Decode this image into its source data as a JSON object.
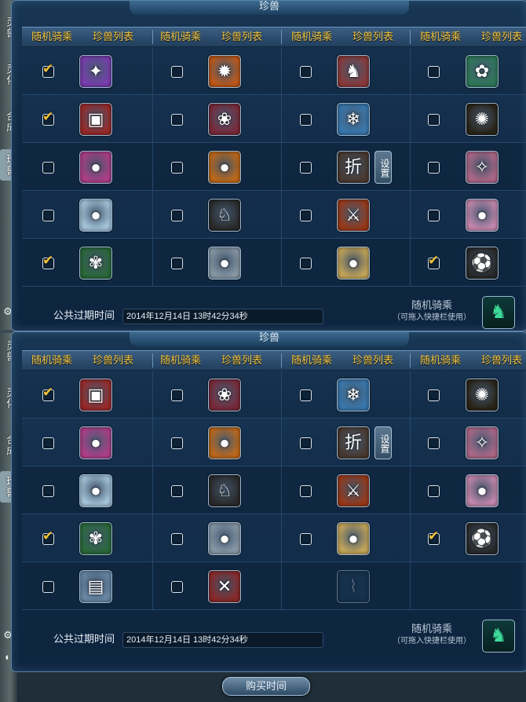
{
  "top": {
    "title": "珍兽",
    "header": [
      "随机骑乘",
      "珍兽列表",
      "随机骑乘",
      "珍兽列表",
      "随机骑乘",
      "珍兽列表",
      "随机骑乘",
      "珍兽列表"
    ],
    "rows": [
      [
        {
          "checked": true,
          "icon": "purple-feather-icon",
          "glyph": "✦",
          "bg": "#7a3fb0"
        },
        {
          "checked": false,
          "icon": "fire-beast-icon",
          "glyph": "✹",
          "bg": "#c05a1a"
        },
        {
          "checked": false,
          "icon": "white-horse-icon",
          "glyph": "♞",
          "bg": "#8c3a3a"
        },
        {
          "checked": false,
          "icon": "green-dragon-icon",
          "glyph": "✿",
          "bg": "#2f7a5a"
        }
      ],
      [
        {
          "checked": true,
          "icon": "red-chest-icon",
          "glyph": "▣",
          "bg": "#9a2a2a"
        },
        {
          "checked": false,
          "icon": "flower-beast-icon",
          "glyph": "❀",
          "bg": "#7a2a3a"
        },
        {
          "checked": false,
          "icon": "blue-alpaca-icon",
          "glyph": "❄",
          "bg": "#3a7ab0"
        },
        {
          "checked": false,
          "icon": "gold-swirl-icon",
          "glyph": "✺",
          "bg": "#2a2418"
        }
      ],
      [
        {
          "checked": false,
          "icon": "pink-alpaca-icon",
          "glyph": "●",
          "bg": "#b0408a"
        },
        {
          "checked": false,
          "icon": "orange-alpaca-icon",
          "glyph": "●",
          "bg": "#c06a1a"
        },
        {
          "checked": false,
          "icon": "discount-badge-icon",
          "glyph": "折",
          "bg": "#4a3a30",
          "setting": "设置"
        },
        {
          "checked": false,
          "icon": "pink-unicorn-icon",
          "glyph": "✧",
          "bg": "#b06a8a"
        }
      ],
      [
        {
          "checked": false,
          "icon": "white-bear-icon",
          "glyph": "●",
          "bg": "#a8c8dc"
        },
        {
          "checked": false,
          "icon": "black-white-horse-icon",
          "glyph": "♘",
          "bg": "#2a2a2a"
        },
        {
          "checked": false,
          "icon": "sword-gift-icon",
          "glyph": "⚔",
          "bg": "#9a3a1a"
        },
        {
          "checked": false,
          "icon": "pink-bear-icon",
          "glyph": "●",
          "bg": "#c88ab0"
        }
      ],
      [
        {
          "checked": true,
          "icon": "green-dragon-scale-icon",
          "glyph": "✾",
          "bg": "#2a6a3a"
        },
        {
          "checked": false,
          "icon": "white-lion-icon",
          "glyph": "●",
          "bg": "#8a9aa8"
        },
        {
          "checked": false,
          "icon": "cream-alpaca-icon",
          "glyph": "●",
          "bg": "#c8a85a"
        },
        {
          "checked": true,
          "icon": "panda-ball-icon",
          "glyph": "⚽",
          "bg": "#2a2a2a"
        }
      ]
    ],
    "footer": {
      "expire_label": "公共过期时间",
      "expire_time": "2014年12月14日 13时42分34秒",
      "ride_label": "随机骑乘",
      "ride_hint": "（可拖入快捷栏使用）"
    }
  },
  "bottom": {
    "title": "珍兽",
    "header": [
      "随机骑乘",
      "珍兽列表",
      "随机骑乘",
      "珍兽列表",
      "随机骑乘",
      "珍兽列表",
      "随机骑乘",
      "珍兽列表"
    ],
    "rows": [
      [
        {
          "checked": true,
          "icon": "red-chest-icon",
          "glyph": "▣",
          "bg": "#9a2a2a"
        },
        {
          "checked": false,
          "icon": "flower-beast-icon",
          "glyph": "❀",
          "bg": "#7a2a3a"
        },
        {
          "checked": false,
          "icon": "blue-alpaca-icon",
          "glyph": "❄",
          "bg": "#3a7ab0"
        },
        {
          "checked": false,
          "icon": "gold-swirl-icon",
          "glyph": "✺",
          "bg": "#2a2418"
        }
      ],
      [
        {
          "checked": false,
          "icon": "pink-alpaca-icon",
          "glyph": "●",
          "bg": "#b0408a"
        },
        {
          "checked": false,
          "icon": "orange-alpaca-icon",
          "glyph": "●",
          "bg": "#c06a1a"
        },
        {
          "checked": false,
          "icon": "discount-badge-icon",
          "glyph": "折",
          "bg": "#4a3a30",
          "setting": "设置"
        },
        {
          "checked": false,
          "icon": "pink-unicorn-icon",
          "glyph": "✧",
          "bg": "#b06a8a"
        }
      ],
      [
        {
          "checked": false,
          "icon": "white-bear-icon",
          "glyph": "●",
          "bg": "#a8c8dc"
        },
        {
          "checked": false,
          "icon": "black-white-horse-icon",
          "glyph": "♘",
          "bg": "#2a2a2a"
        },
        {
          "checked": false,
          "icon": "sword-gift-icon",
          "glyph": "⚔",
          "bg": "#9a3a1a"
        },
        {
          "checked": false,
          "icon": "pink-bear-icon",
          "glyph": "●",
          "bg": "#c88ab0"
        }
      ],
      [
        {
          "checked": true,
          "icon": "green-dragon-scale-icon",
          "glyph": "✾",
          "bg": "#2a6a3a"
        },
        {
          "checked": false,
          "icon": "white-lion-icon",
          "glyph": "●",
          "bg": "#8a9aa8"
        },
        {
          "checked": false,
          "icon": "cream-alpaca-icon",
          "glyph": "●",
          "bg": "#c8a85a"
        },
        {
          "checked": true,
          "icon": "panda-ball-icon",
          "glyph": "⚽",
          "bg": "#2a2a2a"
        }
      ],
      [
        {
          "checked": false,
          "icon": "white-tiger-icon",
          "glyph": "▤",
          "bg": "#6a8aa8"
        },
        {
          "checked": false,
          "icon": "red-cross-scroll-icon",
          "glyph": "✕",
          "bg": "#8a2a2a"
        },
        {
          "empty": true,
          "icon": "empty-slot-icon",
          "glyph": "⌇"
        },
        {
          "empty": true,
          "none": true
        }
      ]
    ],
    "footer": {
      "expire_label": "公共过期时间",
      "expire_time": "2014年12月14日 13时42分34秒",
      "ride_label": "随机骑乘",
      "ride_hint": "（可拖入快捷栏使用）"
    },
    "buy_button": "购买时间"
  },
  "sidebar": {
    "top_tabs": [
      "灵兽",
      "灵化",
      "合成",
      "珍兽"
    ],
    "bottom_tabs": [
      "灵兽",
      "灵化",
      "合成",
      "珍兽"
    ]
  },
  "colors": {
    "header_text": "#f5c842",
    "check": "#f0c33a",
    "panel": "#0f2741",
    "border": "#5a82a8"
  }
}
